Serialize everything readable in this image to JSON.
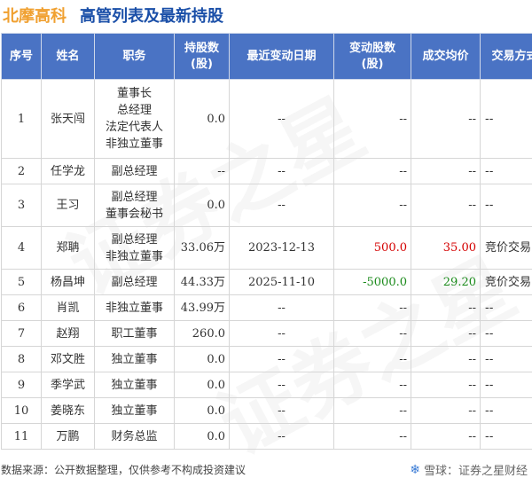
{
  "header": {
    "company": "北摩高科",
    "title": "高管列表及最新持股"
  },
  "table": {
    "columns": [
      "序号",
      "姓名",
      "职务",
      "持股数\n(股)",
      "最近变动日期",
      "变动股数\n(股)",
      "成交均价",
      "交易方式"
    ],
    "rows": [
      {
        "no": "1",
        "name": "张天闯",
        "roles": [
          "董事长",
          "总经理",
          "法定代表人",
          "非独立董事"
        ],
        "shares": "0.0",
        "date": "--",
        "change": "--",
        "price": "--",
        "method": "--"
      },
      {
        "no": "2",
        "name": "任学龙",
        "roles": [
          "副总经理"
        ],
        "shares": "--",
        "date": "--",
        "change": "--",
        "price": "--",
        "method": "--"
      },
      {
        "no": "3",
        "name": "王习",
        "roles": [
          "副总经理",
          "董事会秘书"
        ],
        "shares": "0.0",
        "date": "--",
        "change": "--",
        "price": "--",
        "method": "--"
      },
      {
        "no": "4",
        "name": "郑聃",
        "roles": [
          "副总经理",
          "非独立董事"
        ],
        "shares": "33.06万",
        "date": "2023-12-13",
        "change": "500.0",
        "price": "35.00",
        "method": "竞价交易"
      },
      {
        "no": "5",
        "name": "杨昌坤",
        "roles": [
          "副总经理"
        ],
        "shares": "44.33万",
        "date": "2025-11-10",
        "change": "-5000.0",
        "price": "29.20",
        "method": "竞价交易"
      },
      {
        "no": "6",
        "name": "肖凯",
        "roles": [
          "非独立董事"
        ],
        "shares": "43.99万",
        "date": "--",
        "change": "--",
        "price": "--",
        "method": "--"
      },
      {
        "no": "7",
        "name": "赵翔",
        "roles": [
          "职工董事"
        ],
        "shares": "260.0",
        "date": "--",
        "change": "--",
        "price": "--",
        "method": "--"
      },
      {
        "no": "8",
        "name": "邓文胜",
        "roles": [
          "独立董事"
        ],
        "shares": "0.0",
        "date": "--",
        "change": "--",
        "price": "--",
        "method": "--"
      },
      {
        "no": "9",
        "name": "季学武",
        "roles": [
          "独立董事"
        ],
        "shares": "0.0",
        "date": "--",
        "change": "--",
        "price": "--",
        "method": "--"
      },
      {
        "no": "10",
        "name": "姜晓东",
        "roles": [
          "独立董事"
        ],
        "shares": "0.0",
        "date": "--",
        "change": "--",
        "price": "--",
        "method": "--"
      },
      {
        "no": "11",
        "name": "万鹏",
        "roles": [
          "财务总监"
        ],
        "shares": "0.0",
        "date": "--",
        "change": "--",
        "price": "--",
        "method": "--"
      }
    ]
  },
  "footer": {
    "source": "数据来源：公开数据整理，仅供参考不构成投资建议",
    "brand": "雪球：证券之星财经"
  },
  "watermark": "证券之星",
  "colors": {
    "header_bg": "#4a73c4",
    "company": "#f0a030",
    "title": "#1a4fa8",
    "up": "#d40000",
    "down": "#1a8a1a"
  }
}
